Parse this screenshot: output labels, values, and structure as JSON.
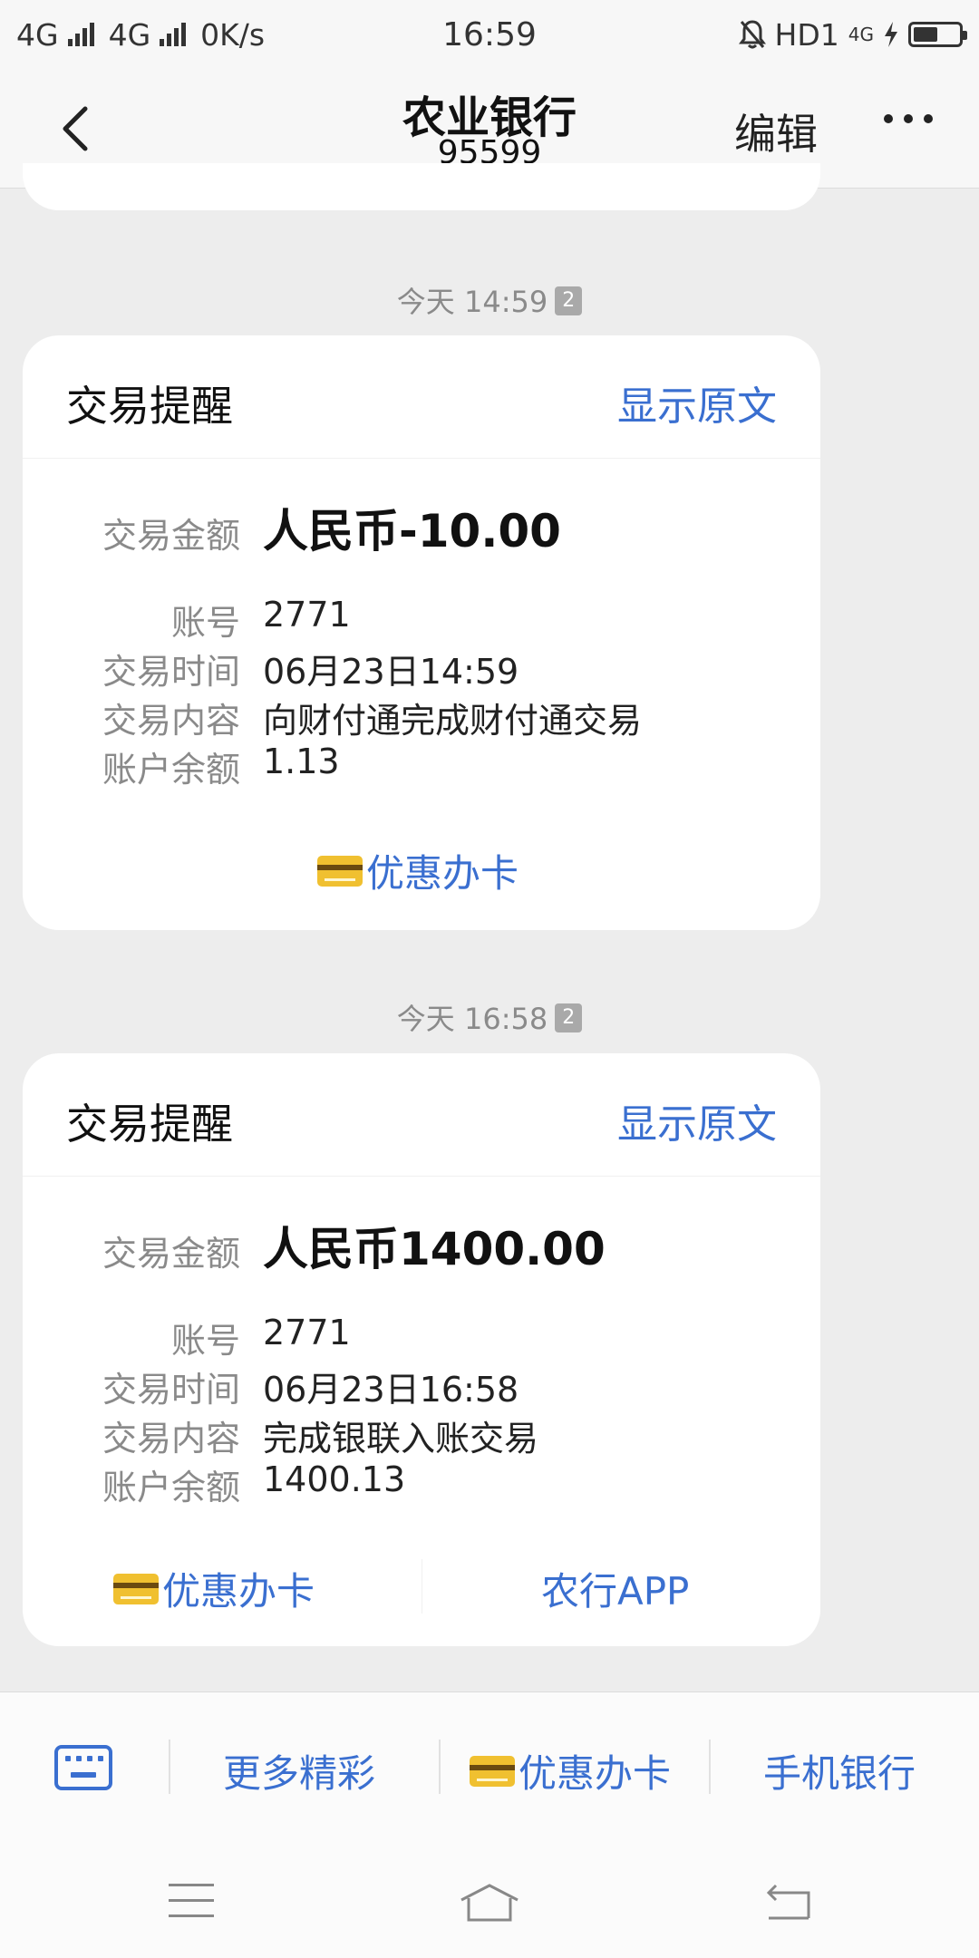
{
  "statusbar": {
    "net1": "4G",
    "net2": "4G",
    "speed": "0K/s",
    "time": "16:59",
    "hd": "HD1",
    "net3": "4G"
  },
  "nav": {
    "title": "农业银行",
    "number": "95599",
    "edit": "编辑"
  },
  "messages": [
    {
      "timestamp": "今天 14:59",
      "badge": "2",
      "card_title": "交易提醒",
      "show_original": "显示原文",
      "amount_label": "交易金额",
      "amount": "人民币-10.00",
      "account_label": "账号",
      "account": "2771",
      "time_label": "交易时间",
      "time": "06月23日14:59",
      "content_label": "交易内容",
      "content": "向财付通完成财付通交易",
      "balance_label": "账户余额",
      "balance": "1.13",
      "link1": "优惠办卡"
    },
    {
      "timestamp": "今天 16:58",
      "badge": "2",
      "card_title": "交易提醒",
      "show_original": "显示原文",
      "amount_label": "交易金额",
      "amount": "人民币1400.00",
      "account_label": "账号",
      "account": "2771",
      "time_label": "交易时间",
      "time": "06月23日16:58",
      "content_label": "交易内容",
      "content": "完成银联入账交易",
      "balance_label": "账户余额",
      "balance": "1400.13",
      "link1": "优惠办卡",
      "link2": "农行APP"
    }
  ],
  "bottombar": {
    "item1": "更多精彩",
    "item2": "优惠办卡",
    "item3": "手机银行"
  },
  "colors": {
    "link": "#3a6fd0",
    "background": "#ededed",
    "card": "#ffffff"
  }
}
